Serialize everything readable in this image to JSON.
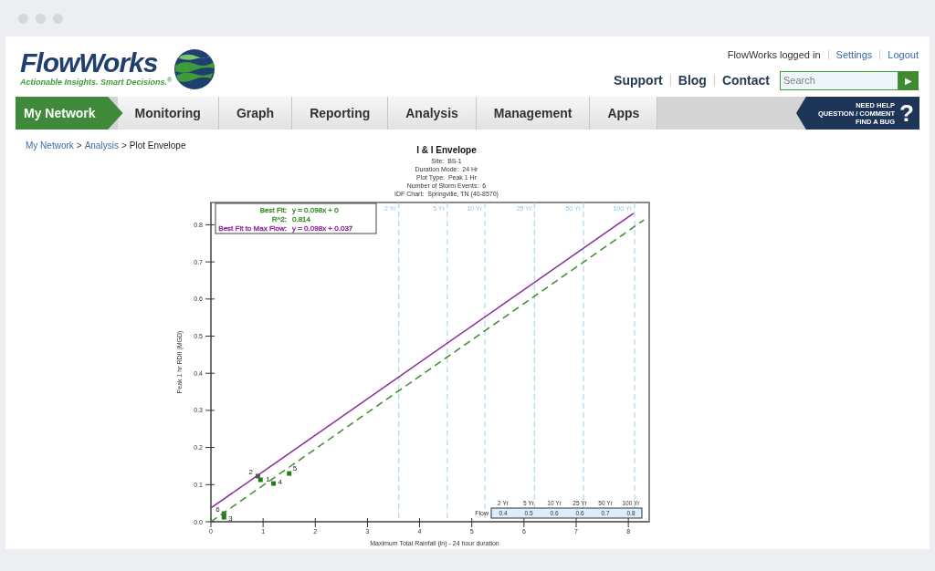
{
  "logo": {
    "name": "FlowWorks",
    "tagline": "Actionable Insights. Smart Decisions.$^{®}$"
  },
  "account": {
    "user": "FlowWorks logged in",
    "links": [
      "Settings",
      "Logout"
    ]
  },
  "top_links": [
    "Support",
    "Blog",
    "Contact"
  ],
  "search": {
    "placeholder": "Search",
    "button": "▶"
  },
  "nav": [
    {
      "label": "My Network",
      "selected": true
    },
    {
      "label": "Monitoring",
      "selected": false
    },
    {
      "label": "Graph",
      "selected": false
    },
    {
      "label": "Reporting",
      "selected": false
    },
    {
      "label": "Analysis",
      "selected": false
    },
    {
      "label": "Management",
      "selected": false
    },
    {
      "label": "Apps",
      "selected": false
    }
  ],
  "help": {
    "lines": [
      "NEED HELP",
      "QUESTION / COMMENT",
      "FIND A BUG"
    ],
    "mark": "?"
  },
  "breadcrumb": [
    {
      "label": "My Network",
      "link": true
    },
    {
      "label": "Analysis",
      "link": true
    },
    {
      "label": "Plot Envelope",
      "link": false
    }
  ],
  "breadcrumb_separator": ">",
  "chart": {
    "title": "I & I Envelope",
    "subtitle": [
      "Site:  BS-1",
      "Duration Mode:  24 Hr",
      "Plot Type:  Peak 1 Hr",
      "Number of Storm Events:  6",
      "IDF Chart:  Springville, TN (40-8570)"
    ],
    "legend": [
      {
        "label": "Best Fit:",
        "value": "y = 0.098x + 0",
        "color": "#3a8f2a"
      },
      {
        "label": "R^2:",
        "value": "0.814",
        "color": "#3a8f2a"
      },
      {
        "label": "Best Fit to Max Flow:",
        "value": "y = 0.098x + 0.037",
        "color": "#8a2a9a"
      }
    ],
    "flow_table": {
      "label": "Flow",
      "columns": [
        "2 Yr",
        "5 Yr",
        "10 Yr",
        "25 Yr",
        "50 Yr",
        "100 Yr"
      ],
      "values": [
        "0.4",
        "0.5",
        "0.6",
        "0.6",
        "0.7",
        "0.8"
      ]
    },
    "chart_data": {
      "type": "scatter",
      "xlabel": "Maximum Total Rainfall (in) - 24 hour duration",
      "ylabel": "Peak 1 hr RDII (MGD)",
      "xlim": [
        0,
        8.4
      ],
      "ylim": [
        0,
        0.86
      ],
      "xticks": [
        0,
        1,
        2,
        3,
        4,
        5,
        6,
        7,
        8
      ],
      "yticks": [
        {
          "value": 0,
          "label": "0.0"
        },
        {
          "value": 0.1,
          "label": "0.1"
        },
        {
          "value": 0.2,
          "label": "0.2"
        },
        {
          "value": 0.3,
          "label": "0.3"
        },
        {
          "value": 0.4,
          "label": "0.4"
        },
        {
          "value": 0.5,
          "label": "0.5"
        },
        {
          "value": 0.6,
          "label": "0.6"
        },
        {
          "value": 0.7,
          "label": "0.7"
        },
        {
          "value": 0.8,
          "label": "0.8"
        }
      ],
      "series": [
        {
          "type": "scatter",
          "color": "#2a7a1e",
          "x": [
            0.95,
            0.9,
            0.25,
            1.2,
            1.5,
            0.25
          ],
          "values": [
            0.113,
            0.123,
            0.012,
            0.103,
            0.13,
            0.022
          ]
        },
        {
          "type": "line",
          "line_style": "dashed",
          "color": "#3a8f2a",
          "x": [
            0,
            8.3
          ],
          "values": [
            0,
            0.813
          ]
        },
        {
          "type": "line",
          "color": "#8a2a9a",
          "x": [
            0,
            8.1
          ],
          "values": [
            0.037,
            0.831
          ]
        }
      ],
      "ref_lines": [
        {
          "axis": "x",
          "value": 3.6,
          "label": "2 Yr"
        },
        {
          "axis": "x",
          "value": 4.53,
          "label": "5 Yr"
        },
        {
          "axis": "x",
          "value": 5.25,
          "label": "10 Yr"
        },
        {
          "axis": "x",
          "value": 6.2,
          "label": "25 Yr"
        },
        {
          "axis": "x",
          "value": 7.14,
          "label": "50 Yr"
        },
        {
          "axis": "x",
          "value": 8.12,
          "label": "100 Yr"
        }
      ],
      "annotations": [
        {
          "x": 0.95,
          "y": 0.113,
          "text": "1"
        },
        {
          "x": 0.9,
          "y": 0.123,
          "text": "2"
        },
        {
          "x": 0.25,
          "y": 0.012,
          "text": "3"
        },
        {
          "x": 1.2,
          "y": 0.103,
          "text": "4"
        },
        {
          "x": 1.5,
          "y": 0.13,
          "text": "5"
        },
        {
          "x": 0.25,
          "y": 0.022,
          "text": "6"
        }
      ]
    }
  }
}
